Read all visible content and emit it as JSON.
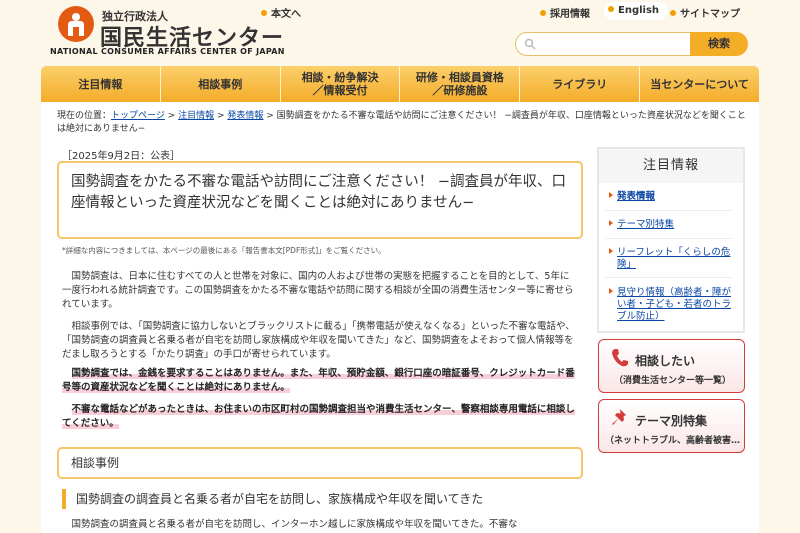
{
  "header": {
    "org_sub": "独立行政法人",
    "org_name": "国民生活センター",
    "org_en": "NATIONAL CONSUMER AFFAIRS CENTER OF JAPAN",
    "skip_link": "本文へ",
    "links": [
      "採用情報",
      "English",
      "サイトマップ"
    ],
    "search_placeholder": "",
    "search_button": "検索"
  },
  "nav": [
    "注目情報",
    "相談事例",
    "相談・紛争解決\n／情報受付",
    "研修・相談員資格\n／研修施設",
    "ライブラリ",
    "当センターについて"
  ],
  "breadcrumb": {
    "prefix": "現在の位置：",
    "links": [
      "トップページ",
      "注目情報",
      "発表情報"
    ],
    "current": "国勢調査をかたる不審な電話や訪問にご注意ください！ −調査員が年収、口座情報といった資産状況などを聞くことは絶対にありません−"
  },
  "article": {
    "date": "［2025年9月2日：公表］",
    "title": "国勢調査をかたる不審な電話や訪問にご注意ください！ −調査員が年収、口座情報といった資産状況などを聞くことは絶対にありません−",
    "note": "*詳細な内容につきましては、本ページの最後にある「報告書本文[PDF形式]」をご覧ください。",
    "para1": "国勢調査は、日本に住むすべての人と世帯を対象に、国内の人および世帯の実態を把握することを目的として、5年に一度行われる統計調査です。この国勢調査をかたる不審な電話や訪問に関する相談が全国の消費生活センター等に寄せられています。",
    "para2": "相談事例では、「国勢調査に協力しないとブラックリストに載る」「携帯電話が使えなくなる」といった不審な電話や、「国勢調査の調査員と名乗る者が自宅を訪問し家族構成や年収を聞いてきた」など、国勢調査をよそおって個人情報等をだまし取ろうとする「かたり調査」の手口が寄せられています。",
    "bold1": "国勢調査では、金銭を要求することはありません。また、年収、預貯金額、銀行口座の暗証番号、クレジットカード番号等の資産状況などを聞くことは絶対にありません。",
    "bold2": "不審な電話などがあったときは、お住まいの市区町村の国勢調査担当や消費生活センター、警察相談専用電話に相談してください。",
    "section_title": "相談事例",
    "case_title": "国勢調査の調査員と名乗る者が自宅を訪問し、家族構成や年収を聞いてきた",
    "case_text": "国勢調査の調査員と名乗る者が自宅を訪問し、インターホン越しに家族構成や年収を聞いてきた。不審な"
  },
  "sidebar": {
    "heading": "注目情報",
    "items": [
      "発表情報",
      "テーマ別特集",
      "リーフレット「くらしの危険」",
      "見守り情報（高齢者・障がい者・子ども・若者のトラブル防止）"
    ],
    "cta1": {
      "title": "相談したい",
      "sub": "（消費生活センター等一覧）"
    },
    "cta2": {
      "title": "テーマ別特集",
      "sub": "（ネットトラブル、高齢者被害…）"
    }
  },
  "colors": {
    "accent": "#f5b93e",
    "brand": "#e35a12",
    "link": "#0b47a5"
  }
}
